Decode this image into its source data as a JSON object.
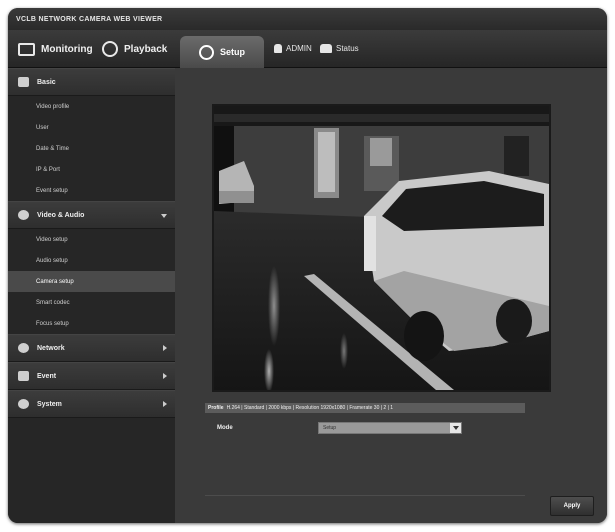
{
  "window": {
    "title": "VCLB NETWORK CAMERA WEB VIEWER"
  },
  "topbar": {
    "monitoring": "Monitoring",
    "playback": "Playback",
    "setup": "Setup",
    "user": "ADMIN",
    "status": "Status"
  },
  "sidebar": {
    "groups": [
      {
        "label": "Basic",
        "expanded": true,
        "items": [
          "Video profile",
          "User",
          "Date & Time",
          "IP & Port",
          "Event setup"
        ]
      },
      {
        "label": "Video & Audio",
        "expanded": true,
        "items": [
          "Video setup",
          "Audio setup",
          "Camera setup",
          "Smart codec",
          "Focus setup"
        ]
      },
      {
        "label": "Network",
        "expanded": false,
        "items": []
      },
      {
        "label": "Event",
        "expanded": false,
        "items": []
      },
      {
        "label": "System",
        "expanded": false,
        "items": []
      }
    ],
    "active_item": "Camera setup"
  },
  "content": {
    "status_label": "Profile",
    "status_text": "H.264 | Standard | 2000 kbps | Resolution 1920x1080 | Framerate 30 | 2 | 1",
    "mode_label": "Mode",
    "mode_value": "Setup",
    "apply_label": "Apply"
  },
  "colors": {
    "background": "#2d2d2d",
    "sidebar": "#262626",
    "active_tab": "#5a5a5a",
    "content": "#3a3a3a"
  }
}
